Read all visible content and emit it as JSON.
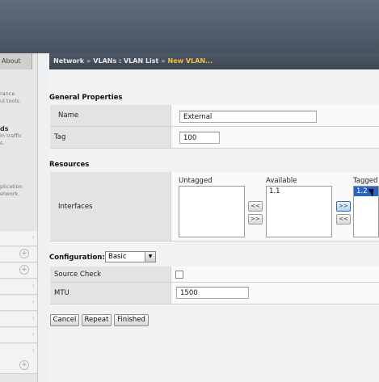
{
  "left_panel": {
    "about_tab": "About",
    "block1": [
      "rance",
      "ul tools."
    ],
    "block2_heading": "ds",
    "block2": [
      "in traffic",
      "s."
    ],
    "block3": [
      "plication",
      "etwork."
    ]
  },
  "breadcrumb": {
    "network": "Network",
    "sep": "»",
    "vlan_list": "VLANs : VLAN List",
    "current": "New VLAN..."
  },
  "general": {
    "title": "General Properties",
    "name_label": "Name",
    "name_value": "External",
    "tag_label": "Tag",
    "tag_value": "100"
  },
  "resources": {
    "title": "Resources",
    "interfaces_label": "Interfaces",
    "untagged_header": "Untagged",
    "available_header": "Available",
    "tagged_header": "Tagged",
    "untagged_items": [],
    "available_items": [
      "1.1"
    ],
    "tagged_items": [
      "1.2"
    ],
    "btn_to_untagged": "<<",
    "btn_from_untagged": ">>",
    "btn_to_tagged": ">>",
    "btn_from_tagged": "<<"
  },
  "configuration": {
    "label": "Configuration:",
    "selected": "Basic",
    "source_check_label": "Source Check",
    "mtu_label": "MTU",
    "mtu_value": "1500"
  },
  "actions": {
    "cancel": "Cancel",
    "repeat": "Repeat",
    "finished": "Finished"
  },
  "colors": {
    "accent": "#2d6cb5",
    "breadcrumb_current": "#f0c040",
    "selection": "#2a63c6"
  }
}
